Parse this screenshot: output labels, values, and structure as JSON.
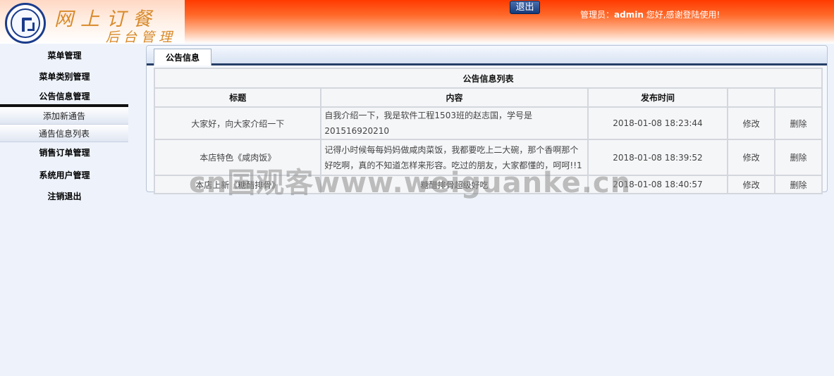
{
  "header": {
    "title_line1": "网上订餐",
    "title_line2": "后台管理",
    "logout_label": "退出",
    "welcome_prefix": "管理员：",
    "username": "admin",
    "welcome_suffix": " 您好,感谢登陆使用!"
  },
  "sidebar": {
    "items": [
      {
        "label": "菜单管理"
      },
      {
        "label": "菜单类别管理"
      },
      {
        "label": "公告信息管理"
      },
      {
        "label": "销售订单管理"
      },
      {
        "label": "系统用户管理"
      },
      {
        "label": "注销退出"
      }
    ],
    "submenu": [
      {
        "label": "添加新通告"
      },
      {
        "label": "通告信息列表"
      }
    ]
  },
  "main": {
    "tab_label": "公告信息",
    "table_caption": "公告信息列表",
    "columns": [
      "标题",
      "内容",
      "发布时间",
      "",
      ""
    ],
    "rows": [
      {
        "title": "大家好，向大家介绍一下",
        "content": "自我介绍一下，我是软件工程1503班的赵志国，学号是201516920210",
        "time": "2018-01-08 18:23:44",
        "edit": "修改",
        "delete": "删除"
      },
      {
        "title": "本店特色《咸肉饭》",
        "content": "记得小时候每每妈妈做咸肉菜饭，我都要吃上二大碗，那个香啊那个好吃啊，真的不知道怎样来形容。吃过的朋友，大家都懂的，呵呵!!1",
        "time": "2018-01-08 18:39:52",
        "edit": "修改",
        "delete": "删除"
      },
      {
        "title": "本店上新《糖醋排骨》",
        "content": "糖醋排骨超级好吃",
        "time": "2018-01-08 18:40:57",
        "edit": "修改",
        "delete": "删除"
      }
    ]
  },
  "watermark": "cn国观客www.weiguanke.cn"
}
